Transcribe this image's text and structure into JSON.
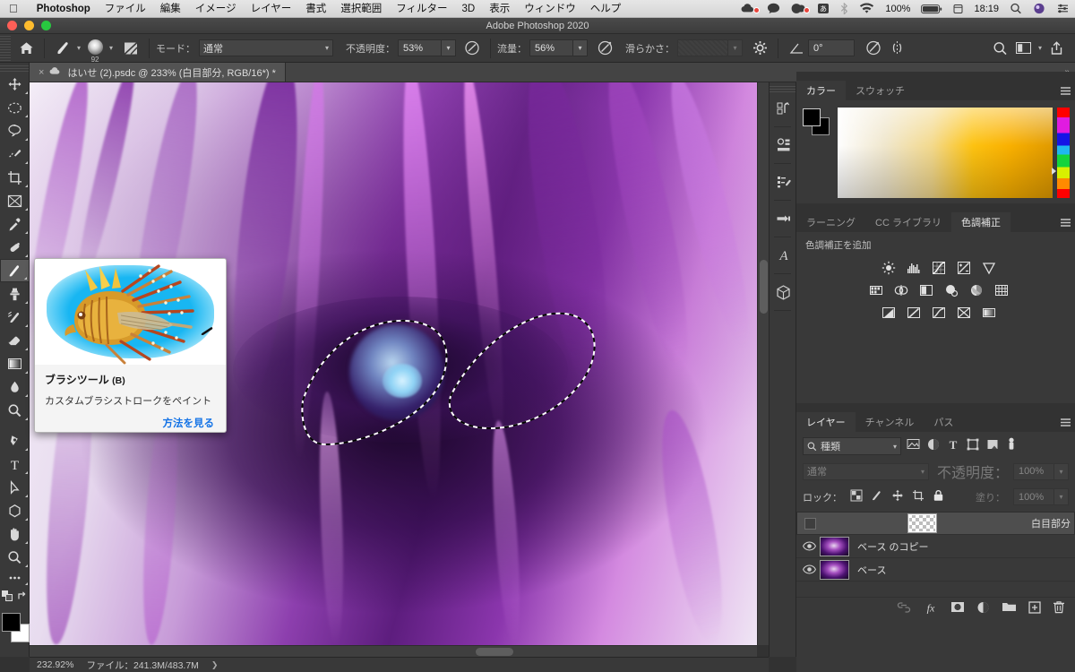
{
  "mac_menu": {
    "apple": "apple-logo",
    "items": [
      {
        "label": "Photoshop",
        "bold": true
      },
      {
        "label": "ファイル"
      },
      {
        "label": "編集"
      },
      {
        "label": "イメージ"
      },
      {
        "label": "レイヤー"
      },
      {
        "label": "書式"
      },
      {
        "label": "選択範囲"
      },
      {
        "label": "フィルター"
      },
      {
        "label": "3D"
      },
      {
        "label": "表示"
      },
      {
        "label": "ウィンドウ"
      },
      {
        "label": "ヘルプ"
      }
    ],
    "status": {
      "battery_percent": "100%",
      "time": "18:19",
      "icons": [
        "cloud-icon",
        "chat-icon",
        "camera-icon",
        "ime-kana-icon",
        "bluetooth-icon",
        "wifi-icon",
        "battery-icon",
        "calendar-icon",
        "search-icon",
        "user-icon",
        "control-center-icon"
      ]
    }
  },
  "window": {
    "title": "Adobe Photoshop 2020",
    "traffic_lights": [
      "close",
      "minimize",
      "zoom"
    ]
  },
  "options_bar": {
    "home_icon": "home-icon",
    "brush_preset_icon": "brush-icon",
    "brush_size": "92",
    "toggle_panel_icon": "brush-settings-icon",
    "mode_label": "モード：",
    "mode_value": "通常",
    "opacity_label": "不透明度：",
    "opacity_value": "53%",
    "pressure_opacity_icon": "pressure-opacity-icon",
    "flow_label": "流量：",
    "flow_value": "56%",
    "airbrush_icon": "airbrush-icon",
    "smoothing_label": "滑らかさ：",
    "smoothing_value": "",
    "smoothing_options_icon": "gear-icon",
    "angle_icon": "angle-icon",
    "angle_value": "0°",
    "pressure_size_icon": "pressure-size-icon",
    "symmetry_icon": "symmetry-icon",
    "search_icon": "search-icon",
    "workspace_icon": "workspace-icon",
    "share_icon": "share-icon"
  },
  "document_tab": {
    "close_label": "×",
    "cloud_icon": "cloud-doc-icon",
    "title": "はいせ (2).psdc @ 233% (白目部分, RGB/16*) *"
  },
  "toolbar": {
    "tools": [
      {
        "name": "move-tool",
        "glyph": "✥",
        "selected": false
      },
      {
        "name": "marquee-tool",
        "glyph": "◌",
        "selected": false
      },
      {
        "name": "lasso-tool",
        "glyph": "◯",
        "selected": false
      },
      {
        "name": "quick-selection-tool",
        "glyph": "❧",
        "selected": false
      },
      {
        "name": "crop-tool",
        "glyph": "⌗",
        "selected": false
      },
      {
        "name": "frame-tool",
        "glyph": "⊠",
        "selected": false
      },
      {
        "name": "eyedropper-tool",
        "glyph": "✑",
        "selected": false
      },
      {
        "name": "healing-brush-tool",
        "glyph": "❥",
        "selected": false
      },
      {
        "name": "brush-tool",
        "glyph": "🖌",
        "selected": true
      },
      {
        "name": "clone-stamp-tool",
        "glyph": "⚲",
        "selected": false
      },
      {
        "name": "history-brush-tool",
        "glyph": "❦",
        "selected": false
      },
      {
        "name": "eraser-tool",
        "glyph": "◣",
        "selected": false
      },
      {
        "name": "gradient-tool",
        "glyph": "▤",
        "selected": false
      },
      {
        "name": "blur-tool",
        "glyph": "💧",
        "selected": false
      },
      {
        "name": "dodge-tool",
        "glyph": "⚆",
        "selected": false
      },
      {
        "name": "pen-tool",
        "glyph": "✒",
        "selected": false
      },
      {
        "name": "type-tool",
        "glyph": "T",
        "selected": false
      },
      {
        "name": "path-selection-tool",
        "glyph": "➤",
        "selected": false
      },
      {
        "name": "shape-tool",
        "glyph": "⬡",
        "selected": false
      },
      {
        "name": "hand-tool",
        "glyph": "✋",
        "selected": false
      },
      {
        "name": "zoom-tool",
        "glyph": "🔍",
        "selected": false
      },
      {
        "name": "edit-toolbar-button",
        "glyph": "•••",
        "selected": false
      }
    ],
    "quick-mask-icon": "quick-mask-icon",
    "screen-mode-icon": "screen-mode-icon",
    "foreground_color": "#000000",
    "background_color": "#ffffff"
  },
  "rich_tooltip": {
    "image_alt": "lionfish-brush-preview",
    "title": "ブラシツール",
    "shortcut": "(B)",
    "description": "カスタムブラシストロークをペイント",
    "link": "方法を見る",
    "link_color": "#1473e6"
  },
  "panel_rail": {
    "items": [
      {
        "name": "history-panel-icon",
        "glyph": "⎌"
      },
      {
        "name": "properties-panel-icon",
        "glyph": "▤"
      },
      {
        "name": "brush-settings-panel-icon",
        "glyph": "🖌"
      },
      {
        "name": "brushes-panel-icon",
        "glyph": "➤"
      },
      {
        "name": "character-panel-icon",
        "glyph": "A"
      },
      {
        "name": "3d-panel-icon",
        "glyph": "⬢"
      }
    ]
  },
  "color_panel": {
    "tabs": [
      {
        "label": "カラー",
        "active": true
      },
      {
        "label": "スウォッチ",
        "active": false
      }
    ],
    "menu_icon": "panel-menu-icon",
    "foreground_color": "#000000",
    "background_color": "#000000",
    "spectrum_name": "color-ramp",
    "hue_strip_name": "hue-strip"
  },
  "adjustments_panel": {
    "tabs": [
      {
        "label": "ラーニング",
        "active": false
      },
      {
        "label": "CC ライブラリ",
        "active": false
      },
      {
        "label": "色調補正",
        "active": true
      }
    ],
    "menu_icon": "panel-menu-icon",
    "title": "色調補正を追加",
    "rows": [
      [
        {
          "name": "brightness-contrast-icon",
          "glyph": "☀"
        },
        {
          "name": "levels-icon",
          "glyph": "▥"
        },
        {
          "name": "curves-icon",
          "glyph": "▩"
        },
        {
          "name": "exposure-icon",
          "glyph": "◪"
        },
        {
          "name": "vibrance-icon",
          "glyph": "▽"
        }
      ],
      [
        {
          "name": "hue-saturation-icon",
          "glyph": "▦"
        },
        {
          "name": "color-balance-icon",
          "glyph": "⚖"
        },
        {
          "name": "black-white-icon",
          "glyph": "◧"
        },
        {
          "name": "photo-filter-icon",
          "glyph": "◉"
        },
        {
          "name": "channel-mixer-icon",
          "glyph": "▩"
        },
        {
          "name": "color-lookup-icon",
          "glyph": "▦"
        }
      ],
      [
        {
          "name": "invert-icon",
          "glyph": "◩"
        },
        {
          "name": "posterize-icon",
          "glyph": "◨"
        },
        {
          "name": "threshold-icon",
          "glyph": "◪"
        },
        {
          "name": "selective-color-icon",
          "glyph": "⧄"
        },
        {
          "name": "gradient-map-icon",
          "glyph": "▭"
        }
      ]
    ]
  },
  "layers_panel": {
    "tabs": [
      {
        "label": "レイヤー",
        "active": true
      },
      {
        "label": "チャンネル",
        "active": false
      },
      {
        "label": "パス",
        "active": false
      }
    ],
    "menu_icon": "panel-menu-icon",
    "filter": {
      "search_icon": "search-icon",
      "kind_label": "種類",
      "filter_icons": [
        "filter-pixel-icon",
        "filter-adjustment-icon",
        "filter-type-icon",
        "filter-shape-icon",
        "filter-smart-icon"
      ],
      "toggle_icon": "filter-toggle-icon"
    },
    "blend_mode": "通常",
    "opacity_label": "不透明度：",
    "opacity_value": "100%",
    "lock_label": "ロック：",
    "lock_icons": [
      "lock-transparent-icon",
      "lock-image-icon",
      "lock-position-icon",
      "lock-artboard-icon",
      "lock-all-icon"
    ],
    "fill_label": "塗り：",
    "fill_value": "100%",
    "layers": [
      {
        "name": "白目部分",
        "visible": false,
        "thumb": "transparent",
        "selected": true
      },
      {
        "name": "ベース のコピー",
        "visible": true,
        "thumb": "art",
        "selected": false
      },
      {
        "name": "ベース",
        "visible": true,
        "thumb": "art",
        "selected": false
      }
    ],
    "footer_icons": [
      {
        "name": "link-layers-icon",
        "glyph": "∞"
      },
      {
        "name": "layer-style-icon",
        "glyph": "fx"
      },
      {
        "name": "layer-mask-icon",
        "glyph": "▣"
      },
      {
        "name": "adjustment-layer-icon",
        "glyph": "◐"
      },
      {
        "name": "new-group-icon",
        "glyph": "▰"
      },
      {
        "name": "new-layer-icon",
        "glyph": "⊞"
      },
      {
        "name": "delete-layer-icon",
        "glyph": "🗑"
      }
    ]
  },
  "status_bar": {
    "zoom": "232.92%",
    "file_label": "ファイル：241.3M/483.7M",
    "arrow": "❯"
  },
  "colors": {
    "panel_bg": "#393939",
    "panel_dark": "#323232",
    "accent_blue": "#1473e6",
    "selected_row": "#4e4e4e"
  }
}
